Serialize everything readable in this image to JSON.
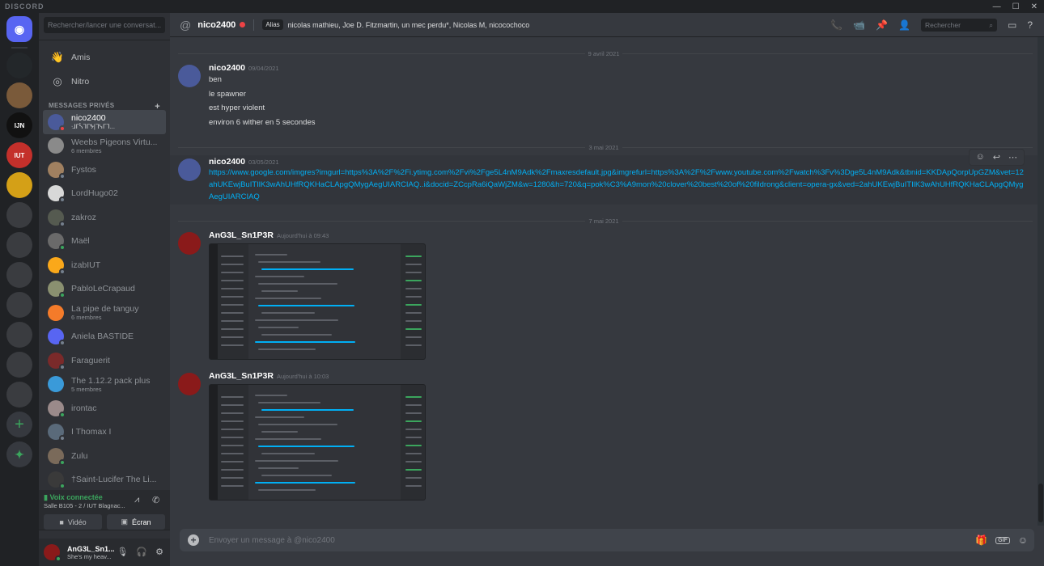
{
  "app": {
    "title": "DISCORD",
    "window_controls": [
      "—",
      "☐",
      "✕"
    ]
  },
  "colors": {
    "accent": "#5865f2",
    "online": "#3ba55d",
    "dnd": "#ed4245",
    "idle": "#faa81a",
    "offline": "#747f8d",
    "link": "#00aff4"
  },
  "servers": [
    {
      "name": "home",
      "abbr": "",
      "color": "#5865f2"
    },
    {
      "name": "server-purple",
      "abbr": "",
      "color": "#23272a"
    },
    {
      "name": "server-portrait",
      "abbr": "",
      "color": "#7a5a3a"
    },
    {
      "name": "server-ijn",
      "abbr": "IJN",
      "color": "#111111"
    },
    {
      "name": "server-iut",
      "abbr": "IUT",
      "color": "#c4302b"
    },
    {
      "name": "server-gold",
      "abbr": "",
      "color": "#d4a017"
    },
    {
      "name": "server-folder-1",
      "abbr": "",
      "color": "#3a3c40"
    },
    {
      "name": "server-folder-2",
      "abbr": "",
      "color": "#3a3c40"
    },
    {
      "name": "server-folder-3",
      "abbr": "",
      "color": "#3a3c40"
    },
    {
      "name": "server-folder-4",
      "abbr": "",
      "color": "#3a3c40"
    },
    {
      "name": "server-folder-5",
      "abbr": "",
      "color": "#3a3c40"
    },
    {
      "name": "server-folder-6",
      "abbr": "",
      "color": "#3a3c40"
    },
    {
      "name": "server-folder-7",
      "abbr": "",
      "color": "#3a3c40"
    }
  ],
  "sidebar": {
    "search_placeholder": "Rechercher/lancer une conversat...",
    "friends_label": "Amis",
    "nitro_label": "Nitro",
    "dm_header": "MESSAGES PRIVÉS",
    "dms": [
      {
        "name": "nico2400",
        "sub": "ᒲᒥᓵᒣᒥᖬ|ᒣᓭᒥᒣ...",
        "status": "dnd",
        "avatar": "#4a5a9a",
        "active": true
      },
      {
        "name": "Weebs Pigeons Virtu...",
        "sub": "6 membres",
        "status": "",
        "avatar": "#8a8a8a",
        "active": false
      },
      {
        "name": "Fystos",
        "sub": "",
        "status": "offline",
        "avatar": "#a08060",
        "active": false
      },
      {
        "name": "LordHugo02",
        "sub": "",
        "status": "offline",
        "avatar": "#d8d8d8",
        "active": false
      },
      {
        "name": "zakroz",
        "sub": "",
        "status": "offline",
        "avatar": "#555a50",
        "active": false
      },
      {
        "name": "Maël",
        "sub": "",
        "status": "online",
        "avatar": "#6a6a6a",
        "active": false
      },
      {
        "name": "izabIUT",
        "sub": "",
        "status": "offline",
        "avatar": "#faa81a",
        "active": false
      },
      {
        "name": "PabloLeCrapaud",
        "sub": "",
        "status": "online",
        "avatar": "#8a9070",
        "active": false
      },
      {
        "name": "La pipe de tanguy",
        "sub": "6 membres",
        "status": "",
        "avatar": "#f47b2a",
        "active": false
      },
      {
        "name": "Aniela BASTIDE",
        "sub": "",
        "status": "offline",
        "avatar": "#5865f2",
        "active": false
      },
      {
        "name": "Faraguerit",
        "sub": "",
        "status": "offline",
        "avatar": "#7a2a2a",
        "active": false
      },
      {
        "name": "The 1.12.2 pack plus",
        "sub": "5 membres",
        "status": "",
        "avatar": "#3a9ad9",
        "active": false
      },
      {
        "name": "irontac",
        "sub": "",
        "status": "online",
        "avatar": "#9a8a8a",
        "active": false
      },
      {
        "name": "I Thomax I",
        "sub": "",
        "status": "offline",
        "avatar": "#5a6a7a",
        "active": false
      },
      {
        "name": "Zulu",
        "sub": "",
        "status": "online",
        "avatar": "#7a6a5a",
        "active": false
      },
      {
        "name": "†Saint-Lucifer The Li...",
        "sub": "",
        "status": "online",
        "avatar": "#3a3a3a",
        "active": false
      }
    ],
    "voice": {
      "title": "Voix connectée",
      "channel": "Salle B105 - 2 / IUT Blagnac...",
      "video_label": "Vidéo",
      "screen_label": "Écran"
    },
    "user": {
      "name": "AnG3L_Sn1...",
      "status_text": "She's my heav..."
    }
  },
  "header": {
    "channel_name": "nico2400",
    "alias_tag": "Alias",
    "alias_text": "nicolas mathieu, Joe D. Fitzmartin, un mec perdu*, Nicolas M, nicocochoco",
    "search_placeholder": "Rechercher"
  },
  "messages": [
    {
      "divider": "9 avril 2021"
    },
    {
      "author": "nico2400",
      "timestamp": "09/04/2021",
      "avatar": "#4a5a9a",
      "lines": [
        "ben",
        "le spawner",
        "est hyper violent",
        "environ 6 wither en 5 secondes"
      ]
    },
    {
      "divider": "3 mai 2021"
    },
    {
      "author": "nico2400",
      "timestamp": "03/05/2021",
      "avatar": "#4a5a9a",
      "link": "https://www.google.com/imgres?imgurl=https%3A%2F%2Fi.ytimg.com%2Fvi%2Fge5L4nM9Adk%2Fmaxresdefault.jpg&imgrefurl=https%3A%2F%2Fwww.youtube.com%2Fwatch%3Fv%3Dge5L4nM9Adk&tbnid=KKDApQorpUpGZM&vet=12ahUKEwjBuITIlK3wAhUHfRQKHaCLApgQMygAegUIARCIAQ..i&docid=ZCcpRa6iQaWjZM&w=1280&h=720&q=pok%C3%A9mon%20clover%20best%20of%20fildrong&client=opera-gx&ved=2ahUKEwjBuITIlK3wAhUHfRQKHaCLApgQMygAegUIARCIAQ"
    },
    {
      "divider": "7 mai 2021"
    },
    {
      "author": "AnG3L_Sn1P3R",
      "timestamp": "Aujourd'hui à 09:43",
      "avatar": "#8a1a1a",
      "image": true
    },
    {
      "author": "AnG3L_Sn1P3R",
      "timestamp": "Aujourd'hui à 10:03",
      "avatar": "#8a1a1a",
      "image": true
    }
  ],
  "composer": {
    "placeholder": "Envoyer un message à @nico2400",
    "gif_label": "GIF"
  }
}
